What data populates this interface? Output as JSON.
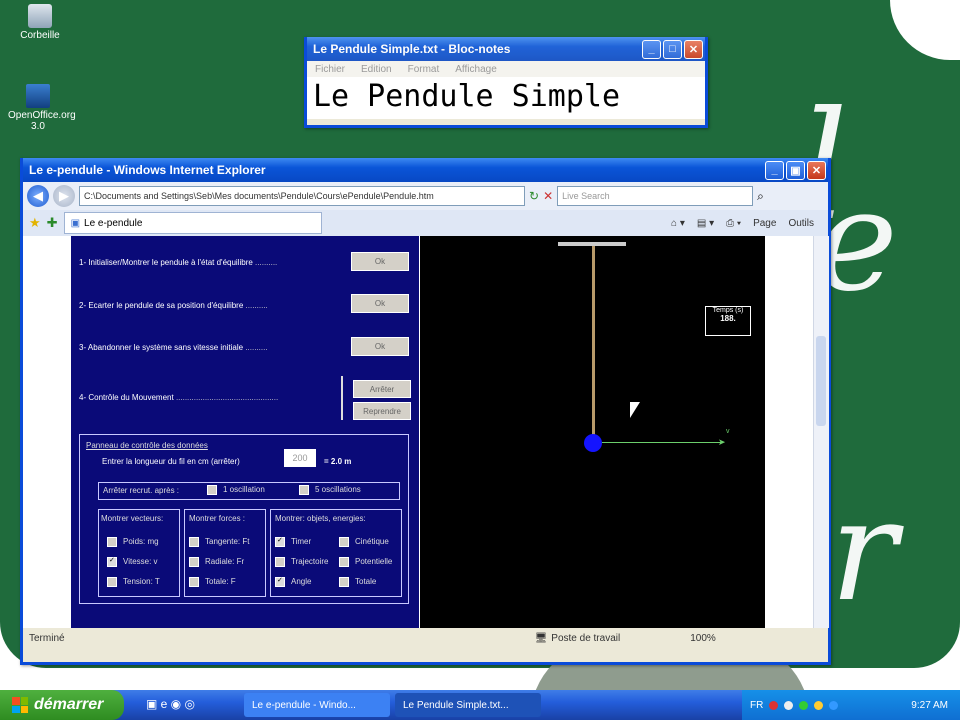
{
  "desktop": {
    "icons": [
      {
        "label": "Corbeille"
      },
      {
        "label": "OpenOffice.org 3.0"
      }
    ]
  },
  "notepad": {
    "title": "Le Pendule Simple.txt - Bloc-notes",
    "menu": [
      "Fichier",
      "Edition",
      "Format",
      "Affichage"
    ],
    "text": "Le Pendule Simple"
  },
  "ie": {
    "title": "Le e-pendule - Windows Internet Explorer",
    "address": "C:\\Documents and Settings\\Seb\\Mes documents\\Pendule\\Cours\\ePendule\\Pendule.htm",
    "search_placeholder": "Live Search",
    "tab_label": "Le e-pendule",
    "tools": [
      "Page",
      "Outils"
    ],
    "status_left": "Terminé",
    "status_zone": "Poste de travail",
    "zoom": "100%"
  },
  "pendule": {
    "steps": [
      {
        "label": "1- Initialiser/Montrer le pendule à l'état d'équilibre",
        "button": "Ok"
      },
      {
        "label": "2- Ecarter le pendule de sa position d'équilibre",
        "button": "Ok"
      },
      {
        "label": "3- Abandonner le système sans vitesse initiale",
        "button": "Ok"
      }
    ],
    "control_label": "4- Contrôle du Mouvement",
    "control_buttons": [
      "Arrêter",
      "Reprendre"
    ],
    "panel_title": "Panneau de contrôle des données",
    "length_label": "Entrer la longueur du fil en cm (arrêter)",
    "length_value": "200",
    "length_result": "= 2.0 m",
    "stop_label": "Arrêter recrut. après :",
    "stop_options": [
      "1 oscillation",
      "5 oscillations"
    ],
    "vectors": {
      "title": "Montrer vecteurs:",
      "items": [
        {
          "label": "Poids: mg",
          "checked": false
        },
        {
          "label": "Vitesse: v",
          "checked": true
        },
        {
          "label": "Tension: T",
          "checked": false
        }
      ]
    },
    "forces": {
      "title": "Montrer forces :",
      "items": [
        {
          "label": "Tangente: Ft",
          "checked": false
        },
        {
          "label": "Radiale: Fr",
          "checked": false
        },
        {
          "label": "Totale: F",
          "checked": false
        }
      ]
    },
    "objects": {
      "title": "Montrer: objets, energies:",
      "items": [
        {
          "label": "Timer",
          "checked": true
        },
        {
          "label": "Cinétique",
          "checked": false
        },
        {
          "label": "Trajectoire",
          "checked": false
        },
        {
          "label": "Potentielle",
          "checked": false
        },
        {
          "label": "Angle",
          "checked": true
        },
        {
          "label": "Totale",
          "checked": false
        }
      ]
    },
    "timer_label": "Temps (s)",
    "timer_value": "188.",
    "arrow_label": "v"
  },
  "taskbar": {
    "start": "démarrer",
    "tasks": [
      "Le e-pendule - Windo...",
      "Le Pendule Simple.txt..."
    ],
    "lang": "FR",
    "clock": "9:27 AM"
  },
  "colors": {
    "desktop_green": "#1f6b3c",
    "xp_blue": "#0a55d8",
    "panel_navy": "#0a0a78",
    "pendulum_ball": "#1414ff"
  }
}
